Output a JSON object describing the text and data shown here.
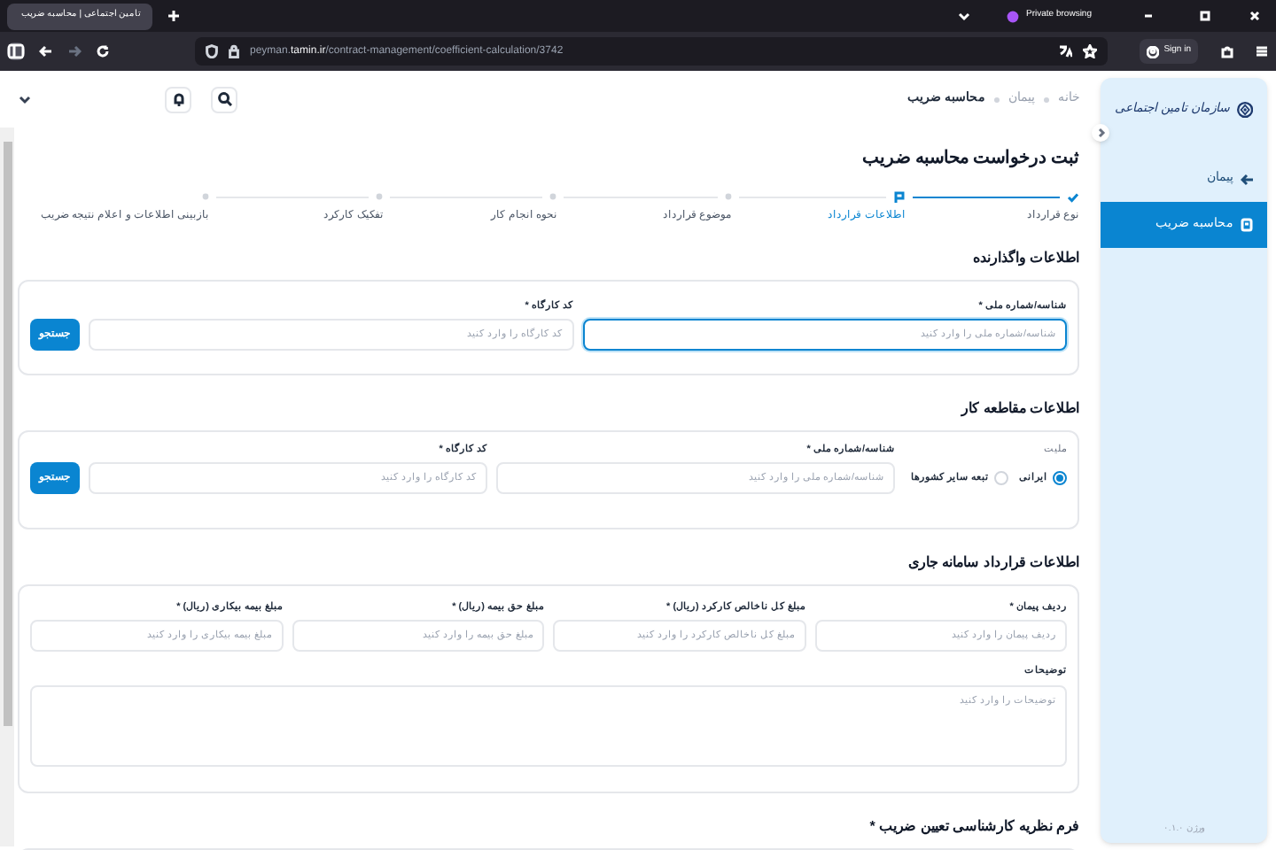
{
  "browser": {
    "tab_title": "تامین اجتماعی | محاسبه ضریب",
    "private_label": "Private browsing",
    "url_host": "peyman.",
    "url_domain": "tamin.ir",
    "url_path": "/contract-management/coefficient-calculation/3742",
    "sign_in": "Sign in"
  },
  "sidebar": {
    "logo_text": "سازمان تامین اجتماعی",
    "items": [
      {
        "label": "پیمان",
        "selected": false,
        "kind": "parent"
      },
      {
        "label": "محاسبه ضریب",
        "selected": true,
        "kind": "page"
      }
    ],
    "version": "ورژن ۰.۱.۰"
  },
  "breadcrumb": [
    "خانه",
    "پیمان",
    "محاسبه ضریب"
  ],
  "page_title": "ثبت درخواست محاسبه ضریب",
  "steps": [
    {
      "label": "نوع قرارداد",
      "done": true,
      "selected": false
    },
    {
      "label": "اطلاعات قرارداد",
      "done": false,
      "selected": true
    },
    {
      "label": "موضوع قرارداد",
      "done": false,
      "selected": false
    },
    {
      "label": "نحوه انجام کار",
      "done": false,
      "selected": false
    },
    {
      "label": "تفکیک کارکرد",
      "done": false,
      "selected": false
    },
    {
      "label": "بازبینی اطلاعات و اعلام نتیجه ضریب",
      "done": false,
      "selected": false
    }
  ],
  "employer": {
    "title": "اطلاعات واگذارنده",
    "fields": [
      {
        "label": "شناسه/شماره ملی *",
        "placeholder": "شناسه/شماره ملی را وارد کنید",
        "focused": true
      },
      {
        "label": "کد کارگاه *",
        "placeholder": "کد کارگاه را وارد کنید",
        "focused": false
      }
    ],
    "button": "جستجو"
  },
  "contractor": {
    "title": "اطلاعات مقاطعه کار",
    "nationality_label": "ملیت",
    "options": [
      {
        "label": "ایرانی",
        "selected": true
      },
      {
        "label": "تبعه سایر کشورها",
        "selected": false
      }
    ],
    "fields": [
      {
        "label": "شناسه/شماره ملی *",
        "placeholder": "شناسه/شماره ملی را وارد کنید",
        "focused": false
      },
      {
        "label": "کد کارگاه *",
        "placeholder": "کد کارگاه را وارد کنید",
        "focused": false
      }
    ],
    "button": "جستجو"
  },
  "contract": {
    "title": "اطلاعات قرارداد سامانه جاری",
    "fields": [
      {
        "label": "ردیف پیمان *",
        "placeholder": "ردیف پیمان را وارد کنید"
      },
      {
        "label": "مبلغ کل ناخالص کارکرد (ریال) *",
        "placeholder": "مبلغ کل ناخالص کارکرد را وارد کنید"
      },
      {
        "label": "مبلغ حق بیمه (ریال) *",
        "placeholder": "مبلغ حق بیمه را وارد کنید"
      },
      {
        "label": "مبلغ بیمه بیکاری (ریال) *",
        "placeholder": "مبلغ بیمه بیکاری را وارد کنید"
      }
    ],
    "notes_label": "توضیحات",
    "notes_placeholder": "توضیحات را وارد کنید"
  },
  "expert_form": {
    "title": "فرم نظریه کارشناسی تعیین ضریب *"
  }
}
